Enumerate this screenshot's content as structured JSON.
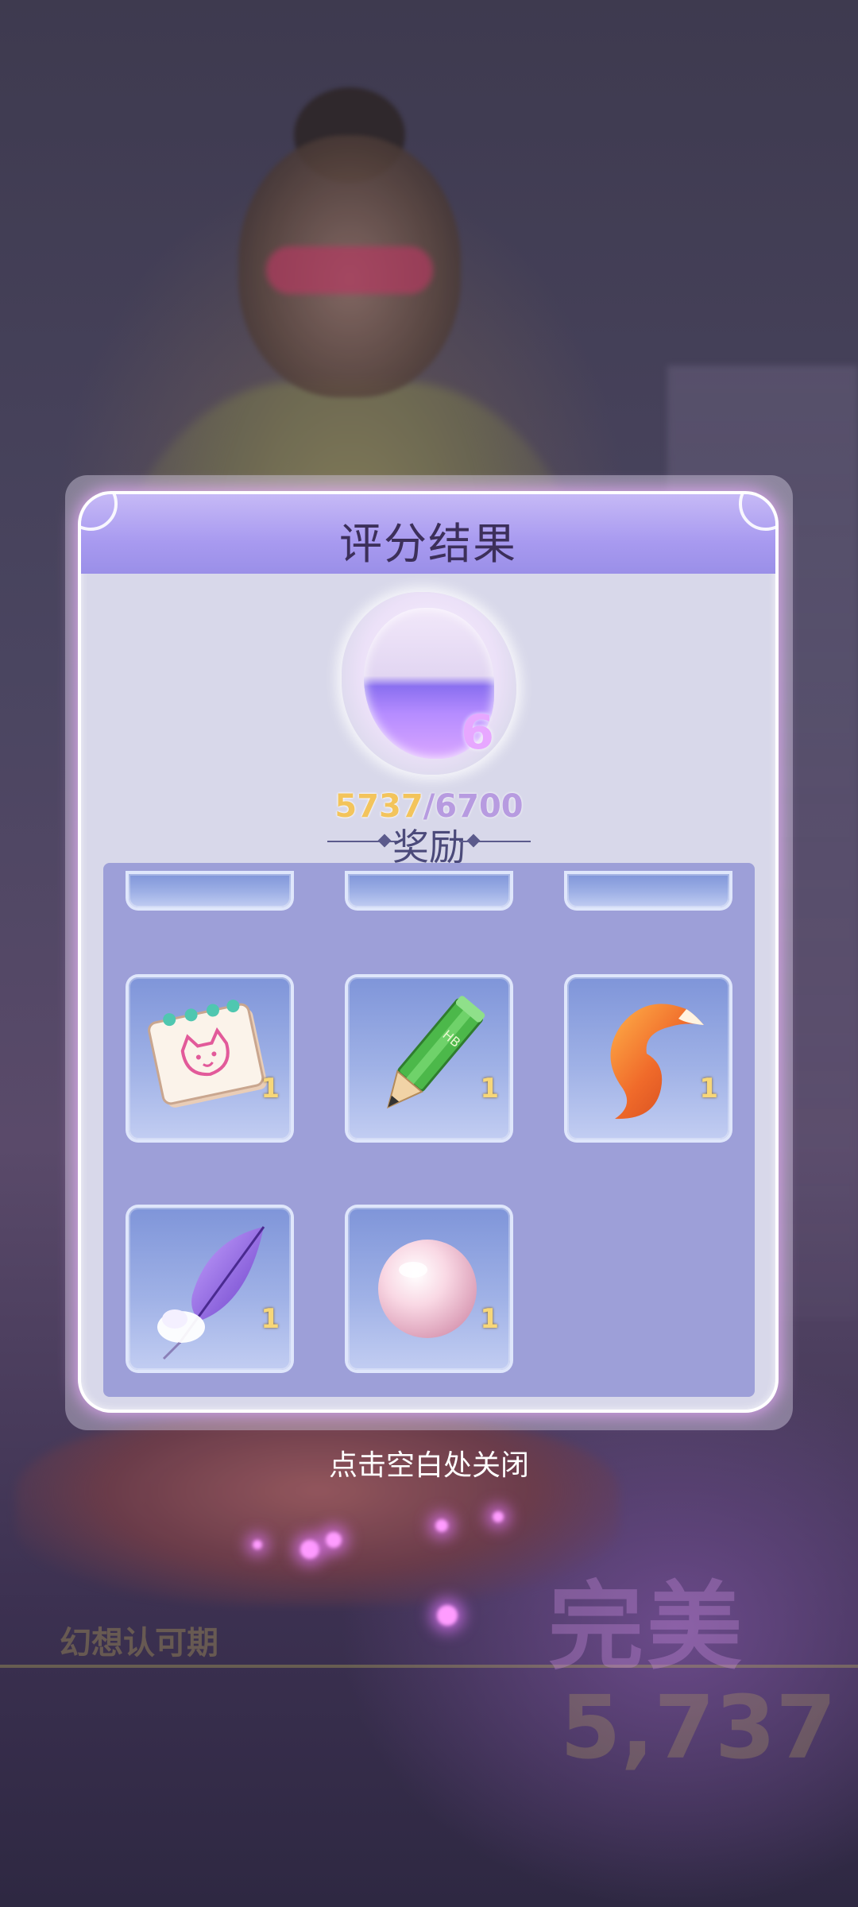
{
  "dialog": {
    "title": "评分结果",
    "rank_number": "6",
    "score_current": "5737",
    "score_separator": "/",
    "score_max": "6700",
    "rewards_heading": "奖励"
  },
  "rewards": [
    {
      "name": "sketchbook-icon",
      "qty": "1"
    },
    {
      "name": "pencil-icon",
      "qty": "1"
    },
    {
      "name": "fox-tail-icon",
      "qty": "1"
    },
    {
      "name": "feather-icon",
      "qty": "1"
    },
    {
      "name": "pearl-icon",
      "qty": "1"
    }
  ],
  "close_hint": "点击空白处关闭",
  "background": {
    "tag": "幻想认可期",
    "grade": "完美",
    "score": "5,737"
  },
  "colors": {
    "header_purple": "#a89af0",
    "panel_lavender": "#9d9fd8",
    "score_gold": "#f3c45c",
    "slot_blue": "#8fa3df"
  }
}
